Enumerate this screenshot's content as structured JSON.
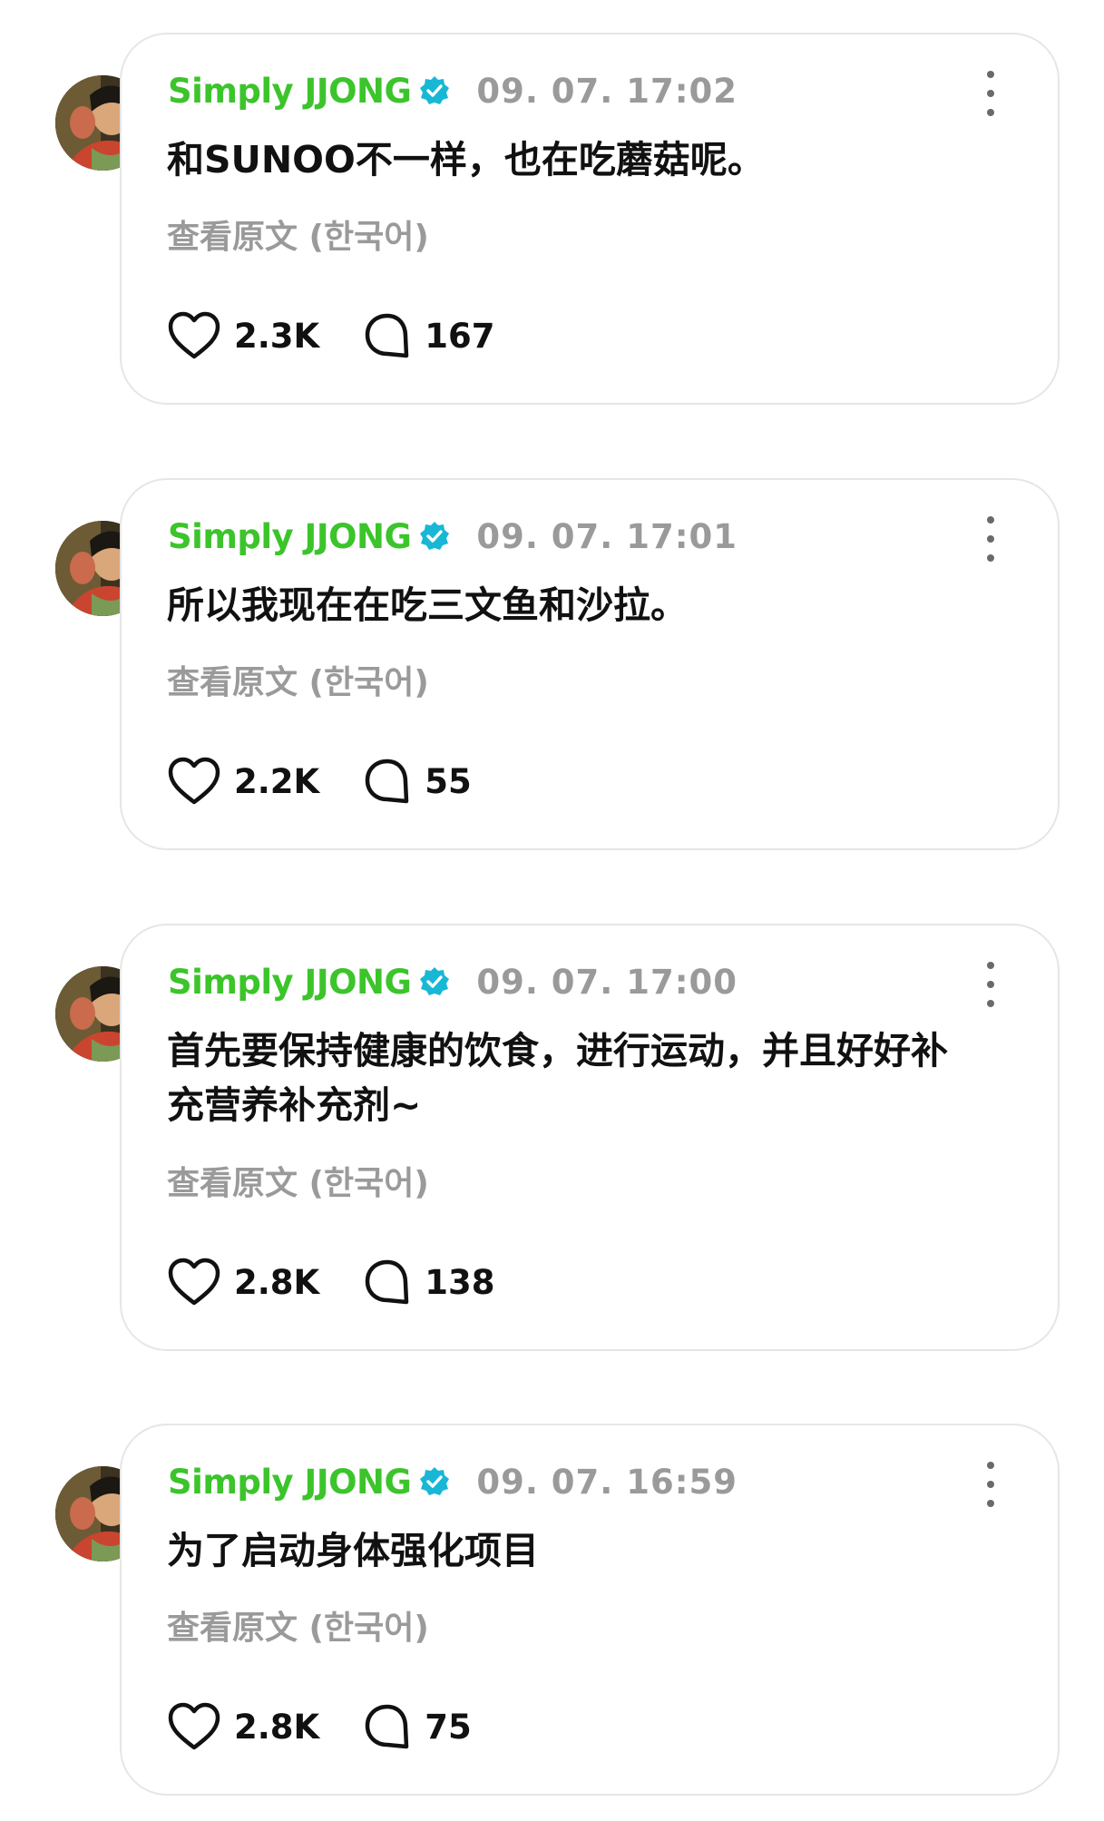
{
  "colors": {
    "author": "#3cc42b",
    "verified": "#18b7d6",
    "meta": "#9a9a9a",
    "border": "#e6e6e6"
  },
  "icons": {
    "verified": "verified-badge-icon",
    "more": "more-vertical-icon",
    "like": "heart-icon",
    "comment": "comment-bubble-icon"
  },
  "posts": [
    {
      "author": "Simply JJONG",
      "timestamp": "09. 07. 17:02",
      "content": "和SUNOO不一样，也在吃蘑菇呢。",
      "translate_label": "查看原文 (한국어)",
      "likes": "2.3K",
      "comments": "167"
    },
    {
      "author": "Simply JJONG",
      "timestamp": "09. 07. 17:01",
      "content": "所以我现在在吃三文鱼和沙拉。",
      "translate_label": "查看原文 (한국어)",
      "likes": "2.2K",
      "comments": "55"
    },
    {
      "author": "Simply JJONG",
      "timestamp": "09. 07. 17:00",
      "content": "首先要保持健康的饮食，进行运动，并且好好补充营养补充剂~",
      "translate_label": "查看原文 (한국어)",
      "likes": "2.8K",
      "comments": "138"
    },
    {
      "author": "Simply JJONG",
      "timestamp": "09. 07. 16:59",
      "content": "为了启动身体强化项目",
      "translate_label": "查看原文 (한국어)",
      "likes": "2.8K",
      "comments": "75"
    }
  ]
}
